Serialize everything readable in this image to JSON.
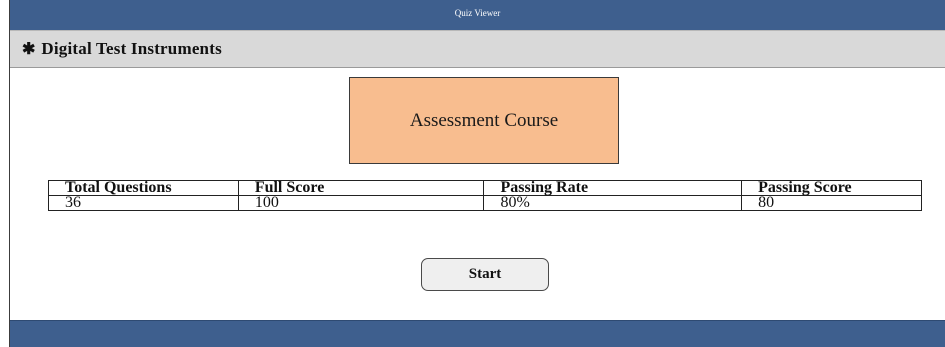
{
  "window": {
    "title": "Quiz Viewer"
  },
  "section": {
    "title": "Digital Test Instruments",
    "icon": "asterisk-icon"
  },
  "course": {
    "title": "Assessment Course",
    "box_color": "#f8bd8f"
  },
  "stats_table": {
    "headers": [
      "Total Questions",
      "Full Score",
      "Passing Rate",
      "Passing Score"
    ],
    "values": [
      "36",
      "100",
      "80%",
      "80"
    ]
  },
  "actions": {
    "start_label": "Start"
  },
  "colors": {
    "titlebar": "#3e5f8e",
    "header_band": "#d9d9d9"
  }
}
